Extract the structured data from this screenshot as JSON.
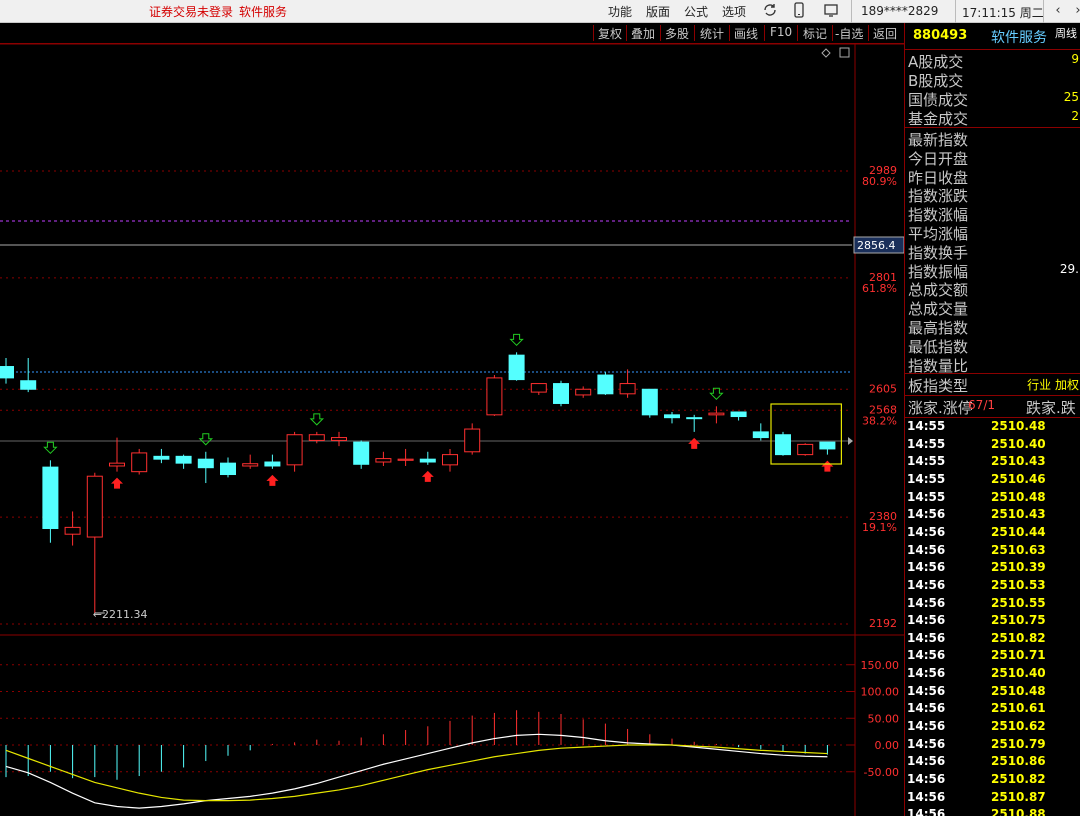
{
  "topbar": {
    "status_left": "证券交易未登录",
    "status_right": "软件服务",
    "menus": [
      "功能",
      "版面",
      "公式",
      "选项"
    ],
    "account": "189****2829",
    "clock": "17:11:15 周二",
    "icons": [
      "refresh-icon",
      "phone-icon",
      "screen-icon",
      "nav-back-icon"
    ]
  },
  "toolbar": {
    "buttons": [
      "复权",
      "叠加",
      "多股",
      "统计",
      "画线",
      "F10",
      "标记",
      "-自选",
      "返回"
    ]
  },
  "chart": {
    "price_labels": [
      {
        "value": "2989",
        "pct": "80.9%"
      },
      {
        "value": "2801",
        "pct": "61.8%"
      },
      {
        "value": "2605",
        "pct": ""
      },
      {
        "value": "2568",
        "pct": "38.2%"
      },
      {
        "value": "2380",
        "pct": "19.1%"
      },
      {
        "value": "2192",
        "pct": ""
      }
    ],
    "current_price_tag": "2856.4",
    "low_marker": "2211.34",
    "macd_labels": [
      "150.00",
      "100.00",
      "50.00",
      "0.00",
      "-50.00"
    ],
    "colors": {
      "up": "#ff3030",
      "down": "#54ffff",
      "grid": "#8b0000",
      "fib": "#ff3030",
      "dif": "#ffffff",
      "dea": "#e6e600"
    }
  },
  "panel": {
    "code": "880493",
    "name": "软件服务",
    "period": "周线",
    "stats": [
      {
        "label": "A股成交",
        "value": "9"
      },
      {
        "label": "B股成交",
        "value": ""
      },
      {
        "label": "国债成交",
        "value": "25"
      },
      {
        "label": "基金成交",
        "value": "2"
      }
    ],
    "quotes": [
      {
        "label": "最新指数",
        "value": ""
      },
      {
        "label": "今日开盘",
        "value": ""
      },
      {
        "label": "昨日收盘",
        "value": ""
      },
      {
        "label": "指数涨跌",
        "value": ""
      },
      {
        "label": "指数涨幅",
        "value": ""
      },
      {
        "label": "平均涨幅",
        "value": ""
      },
      {
        "label": "指数换手",
        "value": ""
      },
      {
        "label": "指数振幅",
        "value": "29."
      },
      {
        "label": "总成交额",
        "value": ""
      },
      {
        "label": "总成交量",
        "value": ""
      },
      {
        "label": "最高指数",
        "value": ""
      },
      {
        "label": "最低指数",
        "value": ""
      },
      {
        "label": "指数量比",
        "value": ""
      }
    ],
    "type_label": "板指类型",
    "type_value": "行业 加权",
    "breadth_label": "涨家.涨停",
    "breadth_value": "67/1",
    "breadth_label2": "跌家.跌",
    "ticks": [
      {
        "time": "14:55",
        "price": "2510.48"
      },
      {
        "time": "14:55",
        "price": "2510.40"
      },
      {
        "time": "14:55",
        "price": "2510.43"
      },
      {
        "time": "14:55",
        "price": "2510.46"
      },
      {
        "time": "14:55",
        "price": "2510.48"
      },
      {
        "time": "14:56",
        "price": "2510.43"
      },
      {
        "time": "14:56",
        "price": "2510.44"
      },
      {
        "time": "14:56",
        "price": "2510.63"
      },
      {
        "time": "14:56",
        "price": "2510.39"
      },
      {
        "time": "14:56",
        "price": "2510.53"
      },
      {
        "time": "14:56",
        "price": "2510.55"
      },
      {
        "time": "14:56",
        "price": "2510.75"
      },
      {
        "time": "14:56",
        "price": "2510.82"
      },
      {
        "time": "14:56",
        "price": "2510.71"
      },
      {
        "time": "14:56",
        "price": "2510.40"
      },
      {
        "time": "14:56",
        "price": "2510.48"
      },
      {
        "time": "14:56",
        "price": "2510.61"
      },
      {
        "time": "14:56",
        "price": "2510.62"
      },
      {
        "time": "14:56",
        "price": "2510.79"
      },
      {
        "time": "14:56",
        "price": "2510.86"
      },
      {
        "time": "14:56",
        "price": "2510.82"
      },
      {
        "time": "14:56",
        "price": "2510.87"
      },
      {
        "time": "14:56",
        "price": "2510.88"
      }
    ]
  },
  "chart_data": {
    "type": "candlestick",
    "candles": [
      {
        "o": 2645,
        "c": 2625,
        "h": 2660,
        "l": 2615
      },
      {
        "o": 2620,
        "c": 2605,
        "h": 2660,
        "l": 2600
      },
      {
        "o": 2468,
        "c": 2360,
        "h": 2480,
        "l": 2335
      },
      {
        "o": 2350,
        "c": 2362,
        "h": 2390,
        "l": 2330
      },
      {
        "o": 2345,
        "c": 2452,
        "h": 2458,
        "l": 2211.34
      },
      {
        "o": 2470,
        "c": 2475,
        "h": 2520,
        "l": 2460
      },
      {
        "o": 2460,
        "c": 2493,
        "h": 2500,
        "l": 2455
      },
      {
        "o": 2487,
        "c": 2482,
        "h": 2500,
        "l": 2475
      },
      {
        "o": 2487,
        "c": 2475,
        "h": 2490,
        "l": 2465
      },
      {
        "o": 2482,
        "c": 2467,
        "h": 2495,
        "l": 2440
      },
      {
        "o": 2475,
        "c": 2455,
        "h": 2485,
        "l": 2450
      },
      {
        "o": 2470,
        "c": 2474,
        "h": 2490,
        "l": 2465
      },
      {
        "o": 2477,
        "c": 2470,
        "h": 2490,
        "l": 2465
      },
      {
        "o": 2472,
        "c": 2525,
        "h": 2530,
        "l": 2460
      },
      {
        "o": 2515,
        "c": 2525,
        "h": 2530,
        "l": 2510
      },
      {
        "o": 2515,
        "c": 2520,
        "h": 2530,
        "l": 2505
      },
      {
        "o": 2512,
        "c": 2473,
        "h": 2515,
        "l": 2465
      },
      {
        "o": 2477,
        "c": 2483,
        "h": 2495,
        "l": 2470
      },
      {
        "o": 2480,
        "c": 2482,
        "h": 2500,
        "l": 2470
      },
      {
        "o": 2482,
        "c": 2477,
        "h": 2495,
        "l": 2472
      },
      {
        "o": 2472,
        "c": 2490,
        "h": 2500,
        "l": 2460
      },
      {
        "o": 2495,
        "c": 2535,
        "h": 2545,
        "l": 2490
      },
      {
        "o": 2560,
        "c": 2625,
        "h": 2630,
        "l": 2558
      },
      {
        "o": 2665,
        "c": 2622,
        "h": 2670,
        "l": 2620
      },
      {
        "o": 2600,
        "c": 2615,
        "h": 2615,
        "l": 2595
      },
      {
        "o": 2615,
        "c": 2580,
        "h": 2620,
        "l": 2575
      },
      {
        "o": 2595,
        "c": 2605,
        "h": 2610,
        "l": 2590
      },
      {
        "o": 2630,
        "c": 2597,
        "h": 2635,
        "l": 2595
      },
      {
        "o": 2597,
        "c": 2615,
        "h": 2640,
        "l": 2590
      },
      {
        "o": 2605,
        "c": 2560,
        "h": 2605,
        "l": 2555
      },
      {
        "o": 2560,
        "c": 2555,
        "h": 2565,
        "l": 2545
      },
      {
        "o": 2555,
        "c": 2554,
        "h": 2560,
        "l": 2530
      },
      {
        "o": 2560,
        "c": 2563,
        "h": 2575,
        "l": 2545
      },
      {
        "o": 2565,
        "c": 2557,
        "h": 2565,
        "l": 2550
      },
      {
        "o": 2530,
        "c": 2520,
        "h": 2545,
        "l": 2515
      },
      {
        "o": 2525,
        "c": 2490,
        "h": 2530,
        "l": 2488
      },
      {
        "o": 2490,
        "c": 2508,
        "h": 2510,
        "l": 2488
      },
      {
        "o": 2512,
        "c": 2500,
        "h": 2512,
        "l": 2490
      }
    ],
    "sell_markers": [
      2,
      9,
      14,
      23,
      32
    ],
    "buy_markers": [
      5,
      12,
      19,
      31,
      37
    ],
    "fib_levels": [
      2989,
      2801,
      2568,
      2380
    ],
    "plain_levels": [
      2605,
      2192
    ],
    "purple_level": 2920,
    "current_price": 2856.4,
    "dotted_cyan_level": 2588,
    "macd": {
      "bars": [
        -60,
        -58,
        -50,
        -62,
        -60,
        -65,
        -58,
        -50,
        -42,
        -30,
        -20,
        -10,
        2,
        5,
        10,
        8,
        14,
        20,
        28,
        35,
        45,
        55,
        60,
        65,
        62,
        58,
        48,
        40,
        30,
        20,
        12,
        6,
        2,
        -4,
        -8,
        -12,
        -16,
        -18
      ],
      "dif": [
        -40,
        -52,
        -70,
        -90,
        -108,
        -115,
        -118,
        -115,
        -110,
        -104,
        -100,
        -96,
        -90,
        -82,
        -72,
        -60,
        -48,
        -36,
        -26,
        -16,
        -6,
        4,
        12,
        18,
        20,
        18,
        14,
        8,
        4,
        2,
        0,
        -4,
        -8,
        -12,
        -16,
        -19,
        -21,
        -22
      ],
      "dea": [
        -10,
        -25,
        -40,
        -55,
        -70,
        -80,
        -90,
        -98,
        -103,
        -104,
        -104,
        -103,
        -100,
        -96,
        -90,
        -84,
        -76,
        -66,
        -56,
        -46,
        -38,
        -30,
        -22,
        -16,
        -10,
        -6,
        -4,
        -2,
        0,
        0,
        0,
        -2,
        -4,
        -7,
        -10,
        -12,
        -14,
        -16
      ]
    }
  }
}
